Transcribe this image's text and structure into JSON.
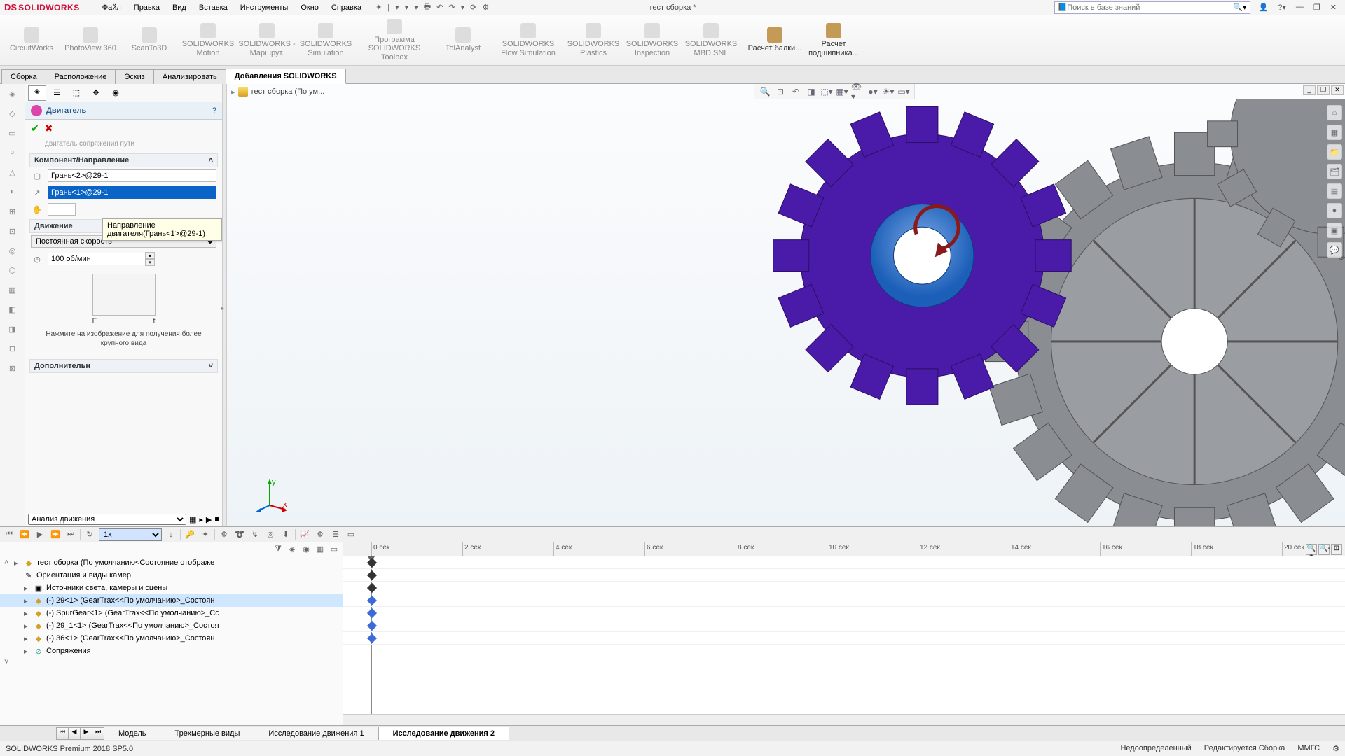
{
  "app": {
    "logo_ds": "DS",
    "logo_sw": "SOLIDWORKS",
    "doc_title": "тест сборка *"
  },
  "menu": {
    "file": "Файл",
    "edit": "Правка",
    "view": "Вид",
    "insert": "Вставка",
    "tools": "Инструменты",
    "window": "Окно",
    "help": "Справка"
  },
  "search": {
    "placeholder": "Поиск в базе знаний"
  },
  "ribbon": {
    "circuitworks": "CircuitWorks",
    "photoview": "PhotoView 360",
    "scanto3d": "ScanTo3D",
    "motion": "SOLIDWORKS Motion",
    "routing": "SOLIDWORKS - Маршрут.",
    "simulation": "SOLIDWORKS Simulation",
    "toolbox": "Программа SOLIDWORKS Toolbox",
    "tolanalyst": "TolAnalyst",
    "flowsim": "SOLIDWORKS Flow Simulation",
    "plastics": "SOLIDWORKS Plastics",
    "inspection": "SOLIDWORKS Inspection",
    "mbd": "SOLIDWORKS MBD SNL",
    "beam": "Расчет балки...",
    "bearing": "Расчет подшипника..."
  },
  "tabs": {
    "assembly": "Сборка",
    "layout": "Расположение",
    "sketch": "Эскиз",
    "evaluate": "Анализировать",
    "addins": "Добавления SOLIDWORKS"
  },
  "breadcrumb": "тест сборка  (По ум...",
  "pm": {
    "title": "Двигатель",
    "stub": "двигатель сопряжения пути",
    "grp_component": "Компонент/Направление",
    "face2": "Грань<2>@29-1",
    "face1": "Грань<1>@29-1",
    "tooltip": "Направление двигателя(Грань<1>@29-1)",
    "grp_motion": "Движение",
    "motion_type": "Постоянная скорость",
    "speed": "100 об/мин",
    "graph_f": "F",
    "graph_t": "t",
    "hint": "Нажмите на изображение для получения более крупного вида",
    "grp_extra": "Дополнительн"
  },
  "motion": {
    "study_type": "Анализ движения",
    "speed_field": "1x",
    "tree": {
      "root": "тест сборка  (По умолчанию<Состояние отображе",
      "orient": "Ориентация и виды камер",
      "lights": "Источники света, камеры и сцены",
      "c1": "(-) 29<1> (GearTrax<<По умолчанию>_Состоян",
      "c2": "(-) SpurGear<1> (GearTrax<<По умолчанию>_Сс",
      "c3": "(-) 29_1<1> (GearTrax<<По умолчанию>_Состоя",
      "c4": "(-) 36<1> (GearTrax<<По умолчанию>_Состоян",
      "mates": "Сопряжения"
    },
    "ticks": [
      "0 сек",
      "2 сек",
      "4 сек",
      "6 сек",
      "8 сек",
      "10 сек",
      "12 сек",
      "14 сек",
      "16 сек",
      "18 сек",
      "20 сек"
    ]
  },
  "bottom_tabs": {
    "model": "Модель",
    "views3d": "Трехмерные виды",
    "study1": "Исследование движения 1",
    "study2": "Исследование движения 2"
  },
  "status": {
    "version": "SOLIDWORKS Premium 2018 SP5.0",
    "underdef": "Недоопределенный",
    "editing": "Редактируется Сборка",
    "units": "ММГС"
  }
}
